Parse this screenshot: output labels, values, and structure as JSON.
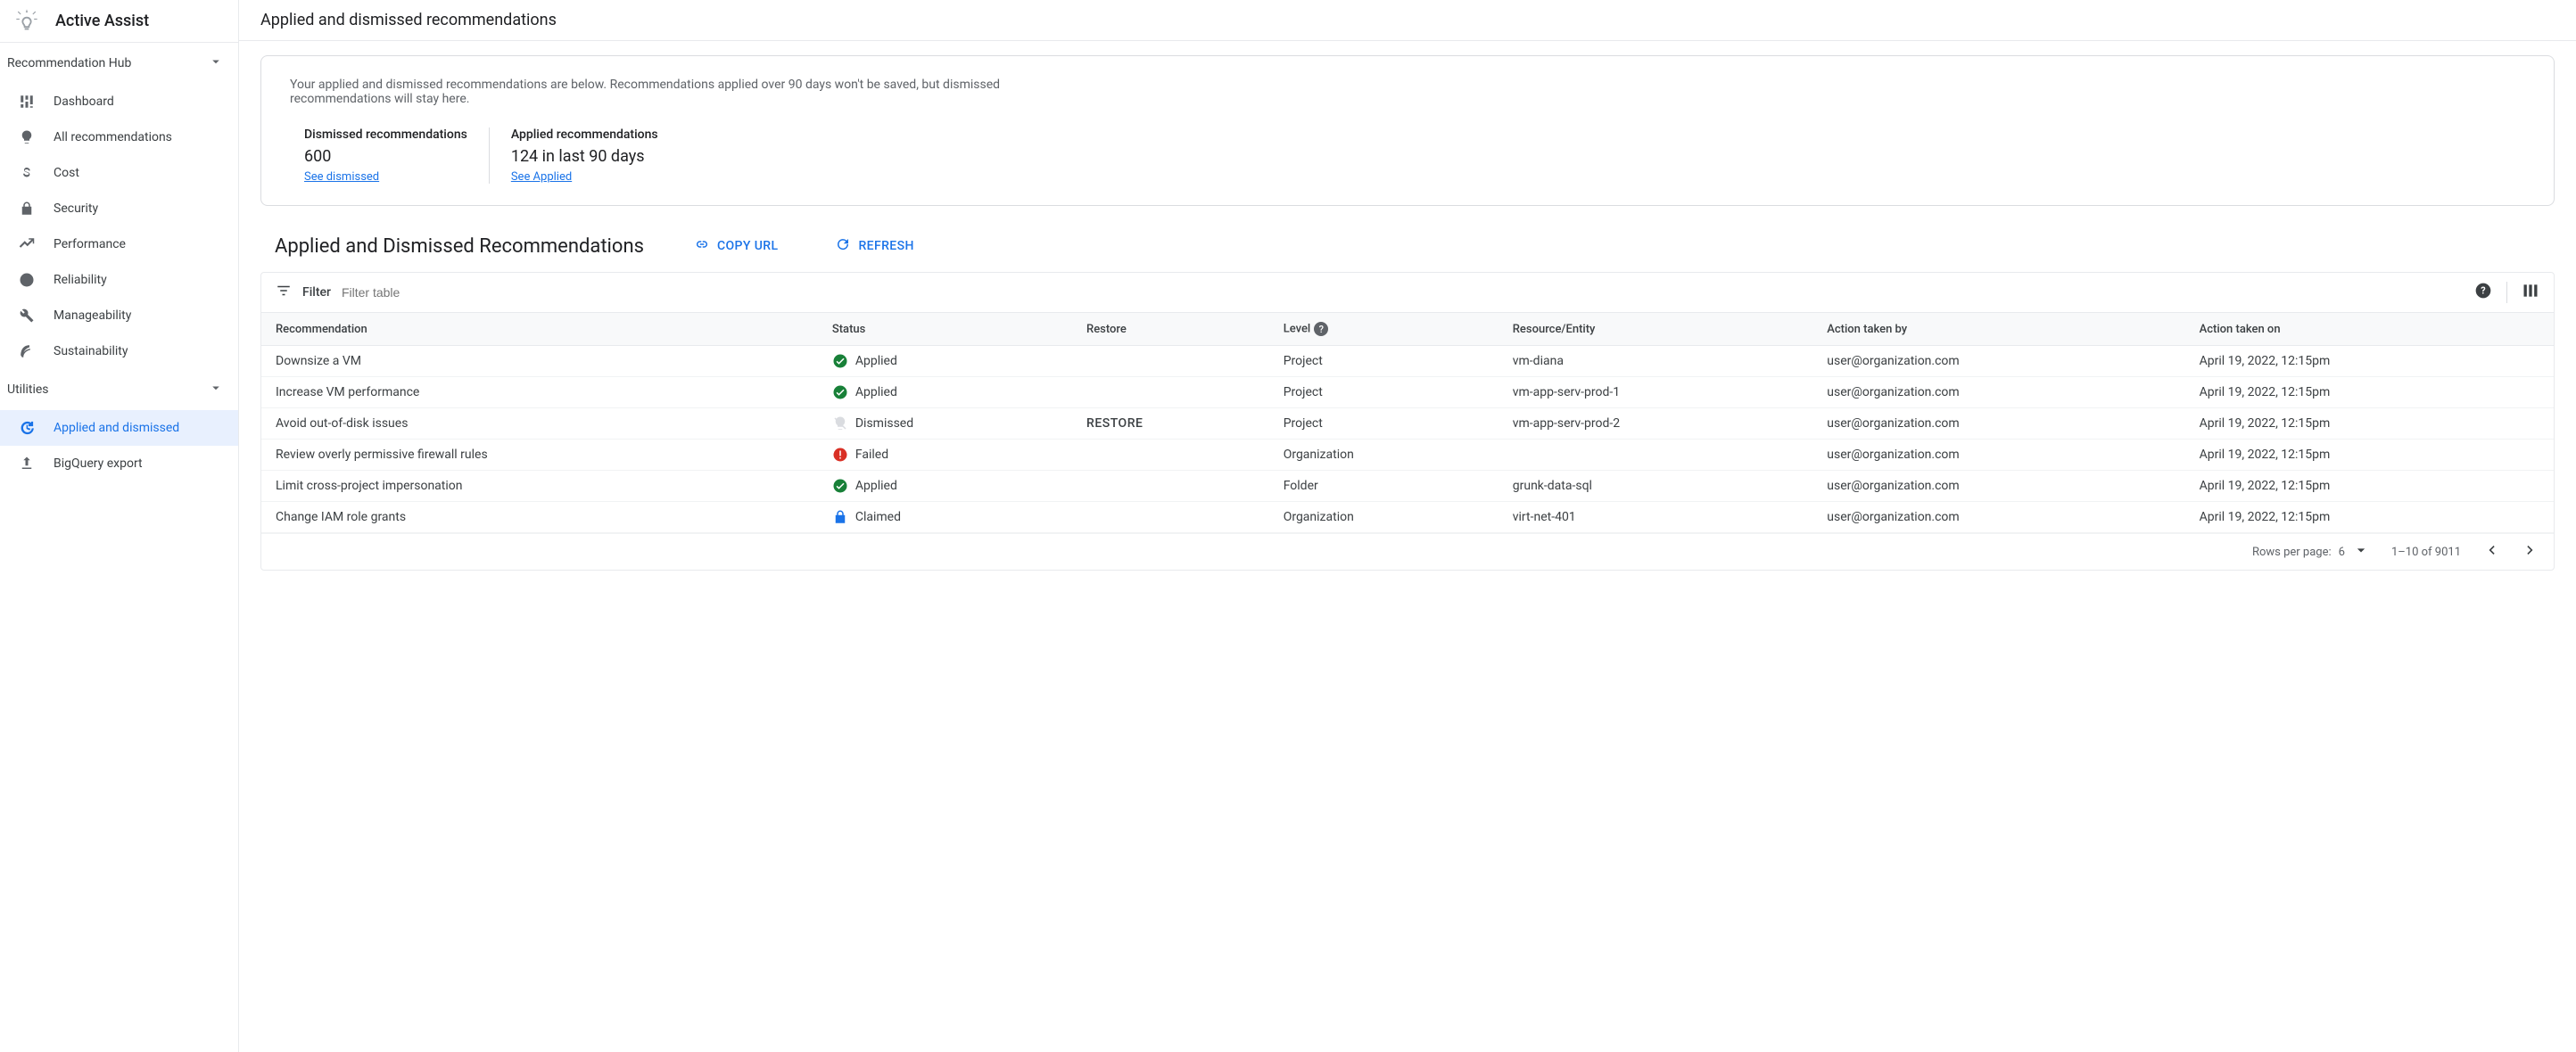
{
  "app": {
    "name": "Active Assist"
  },
  "sidebar": {
    "groups": [
      {
        "label": "Recommendation Hub",
        "items": [
          {
            "label": "Dashboard",
            "icon": "dashboard-icon"
          },
          {
            "label": "All recommendations",
            "icon": "lightbulb-icon"
          },
          {
            "label": "Cost",
            "icon": "dollar-icon"
          },
          {
            "label": "Security",
            "icon": "lock-icon"
          },
          {
            "label": "Performance",
            "icon": "trend-icon"
          },
          {
            "label": "Reliability",
            "icon": "clock-icon"
          },
          {
            "label": "Manageability",
            "icon": "wrench-icon"
          },
          {
            "label": "Sustainability",
            "icon": "leaf-icon"
          }
        ]
      },
      {
        "label": "Utilities",
        "items": [
          {
            "label": "Applied and dismissed",
            "icon": "history-icon",
            "active": true
          },
          {
            "label": "BigQuery export",
            "icon": "export-icon"
          }
        ]
      }
    ]
  },
  "page": {
    "title": "Applied and dismissed recommendations",
    "info_desc": "Your applied and dismissed recommendations are below. Recommendations applied over 90 days won't be saved, but dismissed recommendations will stay here.",
    "stats": [
      {
        "label": "Dismissed recommendations",
        "value": "600",
        "link": "See dismissed"
      },
      {
        "label": "Applied recommendations",
        "value": "124 in last 90 days",
        "link": "See Applied"
      }
    ],
    "section_title": "Applied and Dismissed Recommendations",
    "actions": {
      "copy": "COPY URL",
      "refresh": "REFRESH"
    },
    "filter": {
      "label": "Filter",
      "placeholder": "Filter table"
    },
    "table": {
      "columns": [
        "Recommendation",
        "Status",
        "Restore",
        "Level",
        "Resource/Entity",
        "Action taken by",
        "Action taken on"
      ],
      "rows": [
        {
          "rec": "Downsize a VM",
          "status": "Applied",
          "status_icon": "check",
          "restore": "",
          "level": "Project",
          "resource": "vm-diana",
          "by": "user@organization.com",
          "on": "April 19, 2022, 12:15pm"
        },
        {
          "rec": "Increase VM performance",
          "status": "Applied",
          "status_icon": "check",
          "restore": "",
          "level": "Project",
          "resource": "vm-app-serv-prod-1",
          "by": "user@organization.com",
          "on": "April 19, 2022, 12:15pm"
        },
        {
          "rec": "Avoid out-of-disk issues",
          "status": "Dismissed",
          "status_icon": "dismissed",
          "restore": "RESTORE",
          "level": "Project",
          "resource": "vm-app-serv-prod-2",
          "by": "user@organization.com",
          "on": "April 19, 2022, 12:15pm"
        },
        {
          "rec": "Review overly permissive firewall rules",
          "status": "Failed",
          "status_icon": "failed",
          "restore": "",
          "level": "Organization",
          "resource": "",
          "by": "user@organization.com",
          "on": "April 19, 2022, 12:15pm"
        },
        {
          "rec": "Limit cross-project impersonation",
          "status": "Applied",
          "status_icon": "check",
          "restore": "",
          "level": "Folder",
          "resource": "grunk-data-sql",
          "by": "user@organization.com",
          "on": "April 19, 2022, 12:15pm"
        },
        {
          "rec": "Change IAM role grants",
          "status": "Claimed",
          "status_icon": "claimed",
          "restore": "",
          "level": "Organization",
          "resource": "virt-net-401",
          "by": "user@organization.com",
          "on": "April 19, 2022, 12:15pm"
        }
      ]
    },
    "paginator": {
      "rows_label": "Rows per page:",
      "rows_value": "6",
      "range": "1–10 of 9011"
    }
  }
}
